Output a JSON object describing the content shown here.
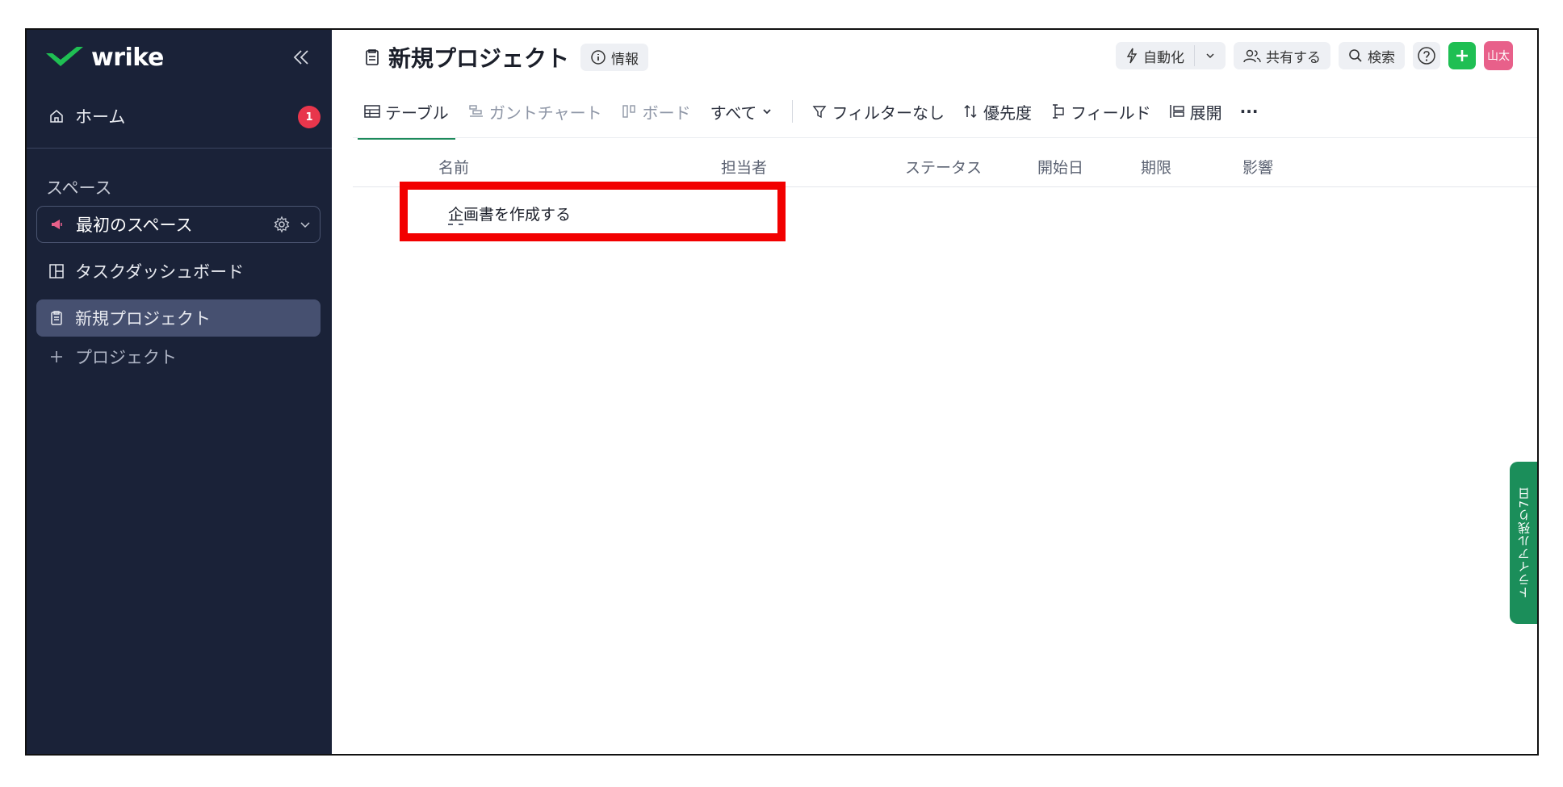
{
  "app": {
    "brand": "wrike",
    "accent": "#1fbf53"
  },
  "sidebar": {
    "home_label": "ホーム",
    "home_badge": "1",
    "space_section": "スペース",
    "space_name": "最初のスペース",
    "items": [
      {
        "label": "タスクダッシュボード",
        "icon": "dashboard-icon"
      },
      {
        "label": "新規プロジェクト",
        "icon": "clipboard-icon",
        "active": true
      },
      {
        "label": "プロジェクト",
        "icon": "plus-icon"
      }
    ]
  },
  "header": {
    "title": "新規プロジェクト",
    "info_label": "情報",
    "automation_label": "自動化",
    "share_label": "共有する",
    "search_label": "検索",
    "avatar_text": "山太"
  },
  "toolbar": {
    "tab_table": "テーブル",
    "tab_gantt": "ガントチャート",
    "tab_board": "ボード",
    "filter_all": "すべて",
    "no_filter": "フィルターなし",
    "priority": "優先度",
    "fields": "フィールド",
    "expand": "展開",
    "more": "···"
  },
  "table": {
    "columns": [
      "名前",
      "担当者",
      "ステータス",
      "開始日",
      "期限",
      "影響"
    ],
    "rows": [
      {
        "name_first": "企",
        "name_rest": "画書を作成する"
      }
    ]
  },
  "trial": {
    "label": "トライアル残り7日"
  }
}
